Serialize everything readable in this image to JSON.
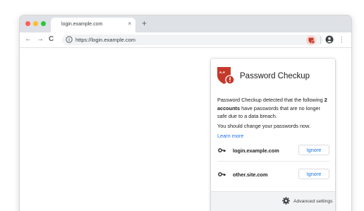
{
  "tab": {
    "title": "login.example.com",
    "close": "×",
    "new_tab": "+"
  },
  "toolbar": {
    "back": "←",
    "forward": "→",
    "reload": "C",
    "url": "https://login.example.com",
    "menu": "⋮"
  },
  "popup": {
    "title": "Password Checkup",
    "desc_pre": "Password Checkup detected that the following ",
    "desc_bold": "2 accounts",
    "desc_post": " have passwords that are no longer safe due to a data breach.",
    "change_text": "You should change your passwords now.",
    "learn_more": "Learn more",
    "accounts": [
      {
        "site": "login.example.com",
        "button": "Ignore"
      },
      {
        "site": "other.site.com",
        "button": "Ignore"
      }
    ],
    "advanced": "Advanced settings"
  },
  "colors": {
    "accent": "#1a73e8",
    "alert_red": "#c5392b",
    "toolbar_bg": "#dee1e6"
  },
  "icons": [
    "info-icon",
    "password-checkup-icon",
    "profile-icon",
    "key-icon",
    "gear-icon"
  ]
}
